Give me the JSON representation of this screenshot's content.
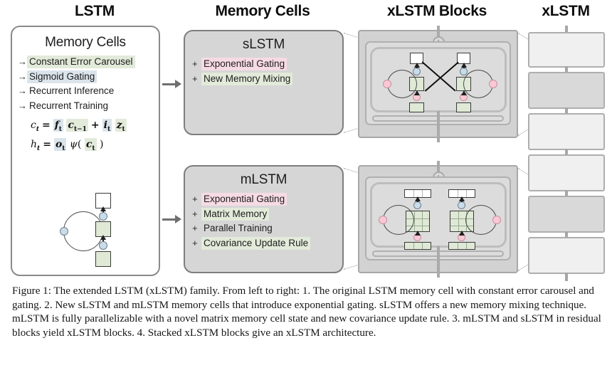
{
  "headings": {
    "lstm": "LSTM",
    "memory_cells": "Memory Cells",
    "xlstm_blocks": "xLSTM Blocks",
    "xlstm": "xLSTM"
  },
  "lstm_panel": {
    "title": "Memory Cells",
    "features": [
      {
        "bullet": "→",
        "text": "Constant Error Carousel",
        "highlight": "green"
      },
      {
        "bullet": "→",
        "text": "Sigmoid Gating",
        "highlight": "blue"
      },
      {
        "bullet": "→",
        "text": "Recurrent Inference",
        "highlight": "none"
      },
      {
        "bullet": "→",
        "text": "Recurrent Training",
        "highlight": "none"
      }
    ],
    "equations": [
      "c_t = f_t c_{t-1} + i_t z_t",
      "h_t = o_t ψ( c_t )"
    ],
    "equation_symbols": {
      "c": "c",
      "h": "h",
      "f": "f",
      "i": "i",
      "z": "z",
      "o": "o",
      "psi": "ψ",
      "t": "t",
      "t_minus_1": "t−1",
      "equals": "=",
      "plus": "+"
    }
  },
  "slstm_panel": {
    "title": "sLSTM",
    "features": [
      {
        "bullet": "+",
        "text": "Exponential Gating",
        "highlight": "pink"
      },
      {
        "bullet": "+",
        "text": "New Memory Mixing",
        "highlight": "green"
      }
    ]
  },
  "mlstm_panel": {
    "title": "mLSTM",
    "features": [
      {
        "bullet": "+",
        "text": "Exponential Gating",
        "highlight": "pink"
      },
      {
        "bullet": "+",
        "text": "Matrix Memory",
        "highlight": "green"
      },
      {
        "bullet": "+",
        "text": "Parallel Training",
        "highlight": "none"
      },
      {
        "bullet": "+",
        "text": "Covariance Update Rule",
        "highlight": "green"
      }
    ]
  },
  "xlstm_stack": {
    "blocks": [
      "light",
      "dark",
      "light",
      "light",
      "dark",
      "light"
    ],
    "count": 6
  },
  "colors": {
    "highlight_green": "#e2ead9",
    "highlight_blue": "#dbe4eb",
    "highlight_pink": "#f7dbe4",
    "cell_green": "#dfe9d6",
    "gate_blue": "#c8dcea",
    "gate_pink": "#f9c8d4",
    "panel_gray": "#d6d6d6",
    "block_gray": "#d2d2d2",
    "stack_light": "#f0f0f0",
    "stack_dark": "#d9d9d9",
    "border_gray": "#8a8a8a",
    "text": "#1a1a1a"
  },
  "caption": {
    "text": "Figure 1: The extended LSTM (xLSTM) family. From left to right: 1. The original LSTM memory cell with constant error carousel and gating. 2. New sLSTM and mLSTM memory cells that introduce exponential gating. sLSTM offers a new memory mixing technique. mLSTM is fully parallelizable with a novel matrix memory cell state and new covariance update rule. 3. mLSTM and sLSTM in residual blocks yield xLSTM blocks. 4. Stacked xLSTM blocks give an xLSTM architecture."
  }
}
